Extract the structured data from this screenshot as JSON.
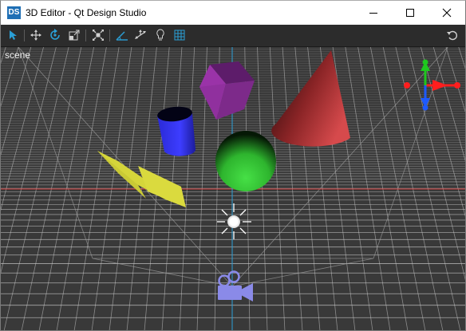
{
  "window": {
    "title": "3D Editor - Qt Design Studio",
    "app_icon_text": "DS",
    "controls": [
      "minimize-icon",
      "maximize-icon",
      "close-icon"
    ]
  },
  "toolbar": {
    "tools": [
      {
        "name": "select-tool",
        "icon": "arrow-pointer-icon",
        "active": true
      },
      {
        "name": "move-tool",
        "icon": "move-arrows-icon"
      },
      {
        "name": "rotate-tool",
        "icon": "rotate-icon"
      },
      {
        "name": "scale-tool",
        "icon": "scale-icon"
      },
      {
        "name": "fit-to-view",
        "icon": "fit-view-icon"
      },
      {
        "name": "perspective-toggle",
        "icon": "perspective-icon"
      },
      {
        "name": "orientation-toggle",
        "icon": "orientation-icon"
      },
      {
        "name": "light-toggle",
        "icon": "bulb-icon"
      },
      {
        "name": "grid-toggle",
        "icon": "grid-icon"
      }
    ],
    "right_tool": {
      "name": "reset-view",
      "icon": "undo-icon"
    }
  },
  "viewport": {
    "label": "scene",
    "background": "#3a3a3a",
    "grid_color": "#cfcfcf",
    "x_axis_color": "#c83232",
    "z_axis_color": "#2a9fd6",
    "objects": [
      {
        "name": "cube",
        "color": "#8a2b9a"
      },
      {
        "name": "cylinder",
        "color": "#2a2ad0"
      },
      {
        "name": "cone",
        "color": "#c0393b"
      },
      {
        "name": "sphere",
        "color": "#3ccf3c"
      },
      {
        "name": "plane",
        "color": "#dada3a"
      },
      {
        "name": "light",
        "color": "#ffffff"
      },
      {
        "name": "camera",
        "color": "#8a8ae8"
      }
    ],
    "axis_helper": {
      "x": "#ff1e1e",
      "y": "#1ec81e",
      "z": "#1e5aff"
    }
  }
}
